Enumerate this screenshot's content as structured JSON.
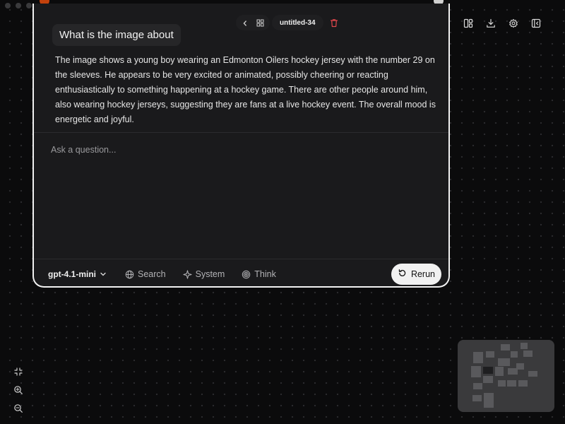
{
  "window": {
    "dots": 3
  },
  "nav": {
    "title": "untitled-34"
  },
  "card": {
    "question": "What is the image about",
    "answer": "The image shows a young boy wearing an Edmonton Oilers hockey jersey with the number 29 on the sleeves. He appears to be very excited or animated, possibly cheering or reacting enthusiastically to something happening at a hockey game. There are other people around him, also wearing hockey jerseys, suggesting they are fans at a live hockey event. The overall mood is energetic and joyful.",
    "input_placeholder": "Ask a question...",
    "input_value": ""
  },
  "toolbar": {
    "model": "gpt-4.1-mini",
    "search_label": "Search",
    "system_label": "System",
    "think_label": "Think",
    "rerun_label": "Rerun"
  },
  "right_tools": [
    "layout-icon",
    "download-icon",
    "settings-icon",
    "collapse-panel-icon"
  ],
  "zoom_tools": [
    "fit-screen-icon",
    "zoom-in-icon",
    "zoom-out-icon"
  ],
  "colors": {
    "background": "#0b0b0c",
    "card": "#1a1a1c",
    "card_border": "#f2f2f2",
    "delete": "#e5484d",
    "rerun_bg": "#f1f1f1"
  }
}
